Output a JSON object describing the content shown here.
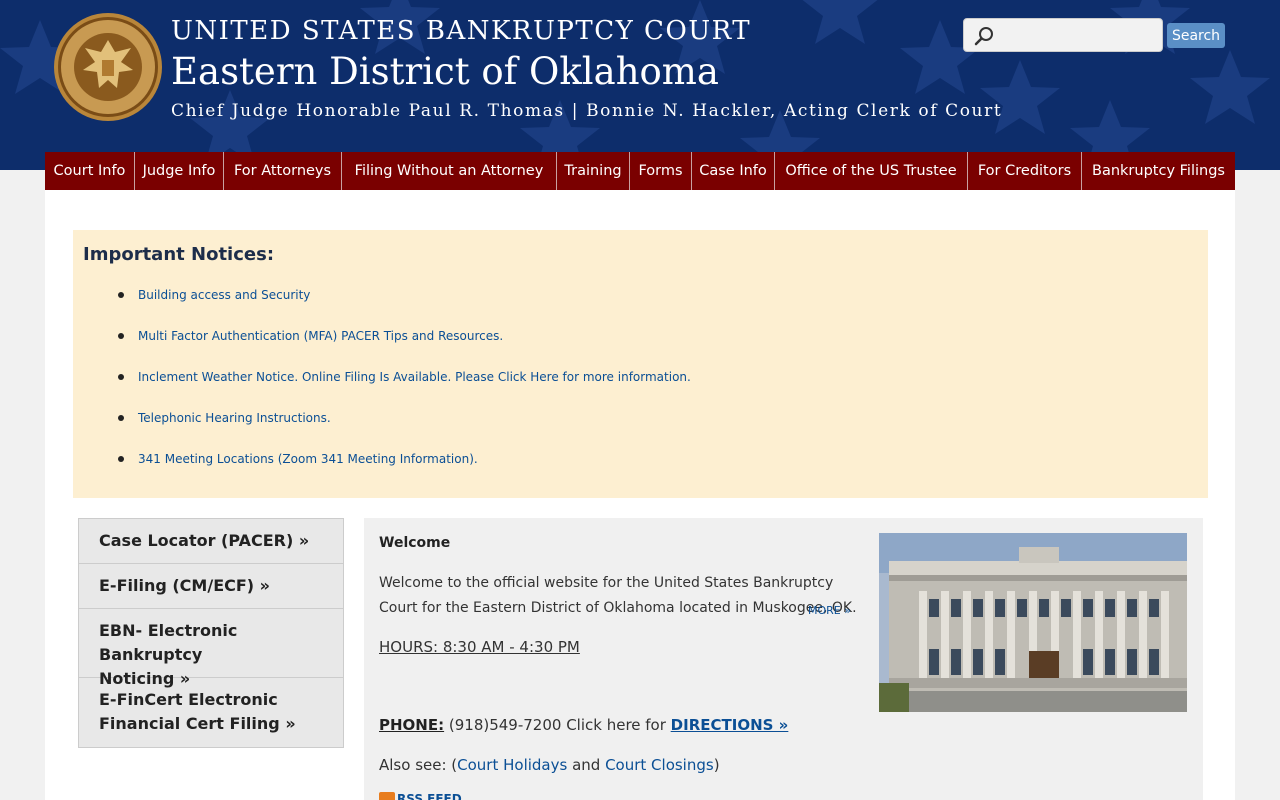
{
  "header": {
    "line1": "UNITED STATES BANKRUPTCY COURT",
    "line2": "Eastern District of Oklahoma",
    "line3": "Chief Judge Honorable Paul R. Thomas | Bonnie N. Hackler, Acting Clerk of Court",
    "seal_text_top": "UNITED STATES BANKRUPTCY COURT",
    "seal_text_bottom": "EASTERN DISTRICT OF OKLAHOMA"
  },
  "search": {
    "placeholder": "",
    "value": "",
    "button_label": "Search"
  },
  "nav": {
    "items": [
      {
        "label": "Court Info"
      },
      {
        "label": "Judge Info"
      },
      {
        "label": "For Attorneys"
      },
      {
        "label": "Filing Without an Attorney"
      },
      {
        "label": "Training"
      },
      {
        "label": "Forms"
      },
      {
        "label": "Case Info"
      },
      {
        "label": "Office of the US Trustee"
      },
      {
        "label": "For Creditors"
      },
      {
        "label": "Bankruptcy Filings"
      }
    ]
  },
  "notices": {
    "title": "Important Notices:",
    "items": [
      "Building access and Security",
      "Multi Factor Authentication (MFA) PACER Tips and Resources.",
      "Inclement Weather Notice. Online Filing Is Available. Please Click Here for more information.",
      "Telephonic Hearing Instructions.",
      "341 Meeting Locations (Zoom 341 Meeting Information)."
    ]
  },
  "sidebar": {
    "items": [
      {
        "line1": "Case Locator (PACER) »",
        "line2": ""
      },
      {
        "line1": "E-Filing (CM/ECF) »",
        "line2": ""
      },
      {
        "line1": "EBN- Electronic Bankruptcy",
        "line2": "Noticing »"
      },
      {
        "line1": "E-FinCert Electronic",
        "line2": "Financial Cert Filing »"
      }
    ]
  },
  "welcome": {
    "title": "Welcome",
    "text": "Welcome to the official website for the United States Bankruptcy Court for the Eastern District of Oklahoma located in Muskogee, OK.",
    "more": "MORE »",
    "hours": "HOURS: 8:30 AM - 4:30 PM",
    "phone_label": "PHONE:",
    "phone_text": " (918)549-7200 Click here for ",
    "directions": "DIRECTIONS »",
    "also_prefix": "Also see:  (",
    "holidays": "Court Holidays",
    "and": " and ",
    "closings": "Court Closings",
    "also_suffix": ")",
    "rss": "RSS FEED"
  },
  "colors": {
    "header_bg": "#0d2d6b",
    "nav_bg": "#7a0000",
    "notice_bg": "#fdefd1",
    "link": "#0b4f95"
  }
}
